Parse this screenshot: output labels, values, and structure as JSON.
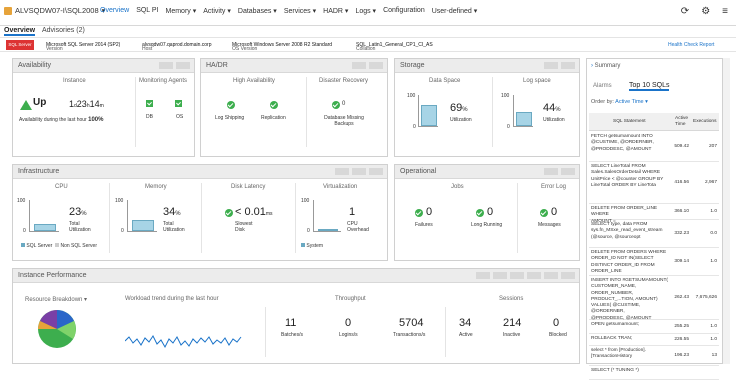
{
  "toolbar": {
    "instance": "ALVSQDW07-I\\SQL2008",
    "arrow": "▾",
    "nav": [
      {
        "label": "Overview",
        "active": true
      },
      {
        "label": "SQL PI"
      },
      {
        "label": "Memory ▾"
      },
      {
        "label": "Activity ▾"
      },
      {
        "label": "Databases ▾"
      },
      {
        "label": "Services ▾"
      },
      {
        "label": "HADR ▾"
      },
      {
        "label": "Logs ▾"
      },
      {
        "label": "Configuration"
      },
      {
        "label": "User-defined ▾"
      }
    ]
  },
  "tabs": {
    "overview": "Overview",
    "advisories": "Advisories (2)"
  },
  "info": {
    "logo": "SQL Server",
    "version_label": "Version",
    "version": "Microsoft SQL Server 2014 (SP2)",
    "host_label": "Host",
    "host": "alvsqdw07.qaprod.domain.corp",
    "os_label": "OS Version",
    "os": "Microsoft Windows Server 2008 R2 Standard",
    "collation_label": "Collation",
    "collation": "SQL_Latin1_General_CP1_CI_AS",
    "health": "Health Check Report"
  },
  "availability": {
    "title": "Availability",
    "instance": "Instance",
    "up": "Up",
    "days": "1",
    "d": "d",
    "hours": "23",
    "h": "h",
    "mins": "14",
    "m": "m",
    "availability_label": "Availability during the last hour",
    "availability_pct": "100%",
    "agents_title": "Monitoring Agents",
    "agent1": "DB",
    "agent2": "OS"
  },
  "hadr": {
    "title": "HA/DR",
    "ha": "High Availability",
    "dr": "Disaster Recovery",
    "log_shipping": "Log Shipping",
    "replication": "Replication",
    "backups": "Database Missing Backups",
    "backups_count": "0"
  },
  "storage": {
    "title": "Storage",
    "data_space": "Data Space",
    "log_space": "Log space",
    "data_pct": "69",
    "data_fill": 0.69,
    "log_pct": "44",
    "log_fill": 0.44,
    "pct": "%",
    "util": "Utilization",
    "axis100": "100",
    "axis0": "0"
  },
  "infra": {
    "title": "Infrastructure",
    "cpu": "CPU",
    "memory": "Memory",
    "disk": "Disk Latency",
    "virt": "Virtualization",
    "cpu_pct": "23",
    "cpu_fill": 0.23,
    "cpu_sub": "Total Utilization",
    "mem_pct": "34",
    "mem_fill": 0.34,
    "mem_sub": "Total Utilization",
    "disk_val": "< 0.01",
    "disk_unit": "ms",
    "disk_sub": "Slowest Disk",
    "virt_val": "1",
    "virt_sub": "CPU Overhead",
    "legend_sql": "SQL Server",
    "legend_non": "Non SQL Server",
    "legend_sys": "System",
    "pct": "%",
    "axis100": "100",
    "axis0": "0"
  },
  "operational": {
    "title": "Operational",
    "jobs": "Jobs",
    "errlog": "Error Log",
    "failures": "0",
    "failures_label": "Failures",
    "long": "0",
    "long_label": "Long Running",
    "messages": "0",
    "messages_label": "Messages"
  },
  "performance": {
    "title": "Instance Performance",
    "breakdown": "Resource Breakdown ▾",
    "workload": "Workload trend during the last hour",
    "throughput": "Throughput",
    "sessions": "Sessions",
    "batches": "11",
    "batches_label": "Batches/s",
    "logins": "0",
    "logins_label": "Logins/s",
    "tx": "5704",
    "tx_label": "Transactions/s",
    "active": "34",
    "active_label": "Active",
    "inactive": "214",
    "inactive_label": "Inactive",
    "blocked": "0",
    "blocked_label": "Blocked"
  },
  "summary": {
    "title": "Summary",
    "alarms": "Alarms",
    "top10": "Top 10 SQLs",
    "order": "Order by:",
    "order_val": "Active Time ▾",
    "col1": "SQL Statement",
    "col2": "Active Time",
    "col3": "Executions",
    "rows": [
      {
        "sql": "FETCH getsumamount INTO\n@CUSTIME, @ORDERNBR,\n@PRODDESC, @AMOUNT",
        "time": "509.42",
        "exec": "207"
      },
      {
        "sql": "SELECT LineTotal FROM\nSales.SalesOrderDetail WHERE\nUnitPrice < @counter GROUP BY\nLineTotal ORDER BY LineTota",
        "time": "416.56",
        "exec": "2,967"
      },
      {
        "sql": "DELETE FROM ORDER_LINE WHERE\nAMOUNT =",
        "time": "366.10",
        "exec": "1.0"
      },
      {
        "sql": "SELECT type, data FROM\nsys.fn_MSxe_read_event_stream\n(@source, @sourceopt",
        "time": "332.23",
        "exec": "0.0"
      },
      {
        "sql": "DELETE FROM ORDERS WHERE\nORDER_ID NOT IN(SELECT\nDISTINCT ORDER_ID FROM\nORDER_LINE",
        "time": "309.14",
        "exec": "1.0"
      },
      {
        "sql": "INSERT INTO #GETSUMAMOUNT(\nCUSTOMER_NAME,\nORDER_NUMBER,\nPRODUCT_...TION, AMOUNT)\nVALUES( @CUSTIME, @ORDERNBR,\n@PRODDESC, @AMOUNT",
        "time": "262.43",
        "exec": "7,675,626"
      },
      {
        "sql": "OPEN getsumamount;",
        "time": "255.25",
        "exec": "1.0"
      },
      {
        "sql": "ROLLBACK TRAN;",
        "time": "226.55",
        "exec": "1.0"
      },
      {
        "sql": "select * from [Production].\n[TransactionHistory",
        "time": "196.23",
        "exec": "13"
      },
      {
        "sql": "SELECT (* TUNING *)",
        "time": "",
        "exec": ""
      }
    ]
  },
  "colors": {
    "green": "#3dae4e",
    "blue": "#1a73c9",
    "bar": "#a7d4e6"
  }
}
